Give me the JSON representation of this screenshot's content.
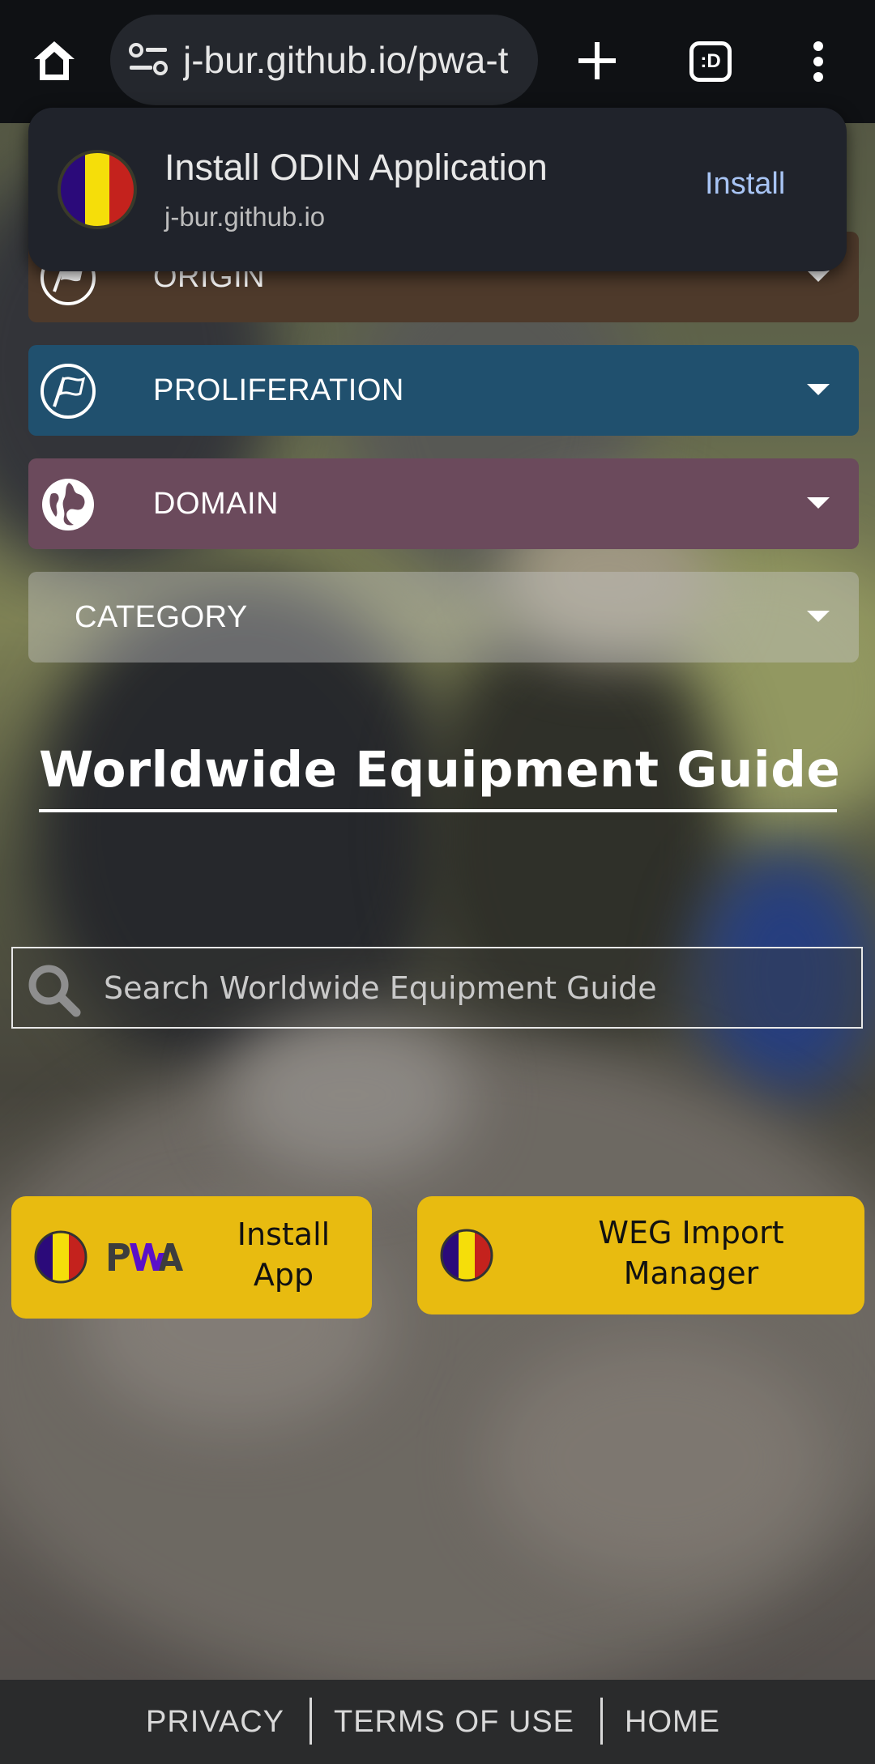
{
  "browser": {
    "url": "j-bur.github.io/pwa-t",
    "tab_count_label": ":D"
  },
  "install_banner": {
    "title": "Install ODIN Application",
    "host": "j-bur.github.io",
    "action": "Install"
  },
  "accordion": [
    {
      "label": "ORIGIN",
      "icon": "flag-icon",
      "color": "#4e3a2b"
    },
    {
      "label": "PROLIFERATION",
      "icon": "flag-icon",
      "color": "#20506e"
    },
    {
      "label": "DOMAIN",
      "icon": "globe-icon",
      "color": "#6b4a5c"
    },
    {
      "label": "CATEGORY",
      "icon": "",
      "color": "#c8c8c8"
    }
  ],
  "page": {
    "title": "Worldwide Equipment Guide"
  },
  "search": {
    "placeholder": "Search Worldwide Equipment Guide"
  },
  "buttons": {
    "install_app": "Install App",
    "pwa_logo_text": "PWA",
    "weg_import": "WEG Import Manager"
  },
  "footer": {
    "links": [
      "PRIVACY",
      "TERMS OF USE",
      "HOME"
    ]
  },
  "colors": {
    "accent_yellow": "#e8bb10",
    "banner_bg": "#20232b",
    "install_link": "#a8c4f4"
  }
}
